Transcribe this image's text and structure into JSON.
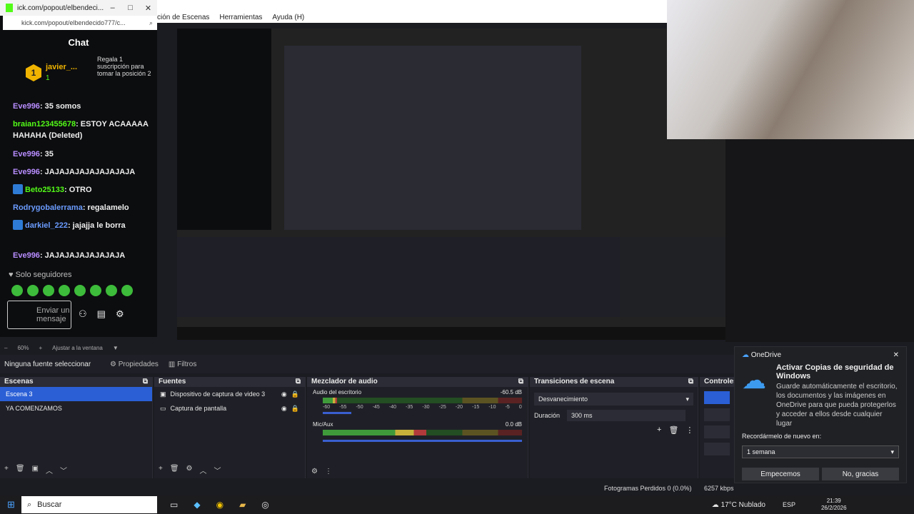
{
  "chat": {
    "window_url": "ick.com/popout/elbendeci...",
    "address": "kick.com/popout/elbendecido777/c...",
    "title": "Chat",
    "sub_badge_count": "1",
    "sub_user": "javier_...",
    "sub_user_count": "1",
    "sub_prompt": "Regala 1 suscripción para tomar la posición 2",
    "messages": [
      {
        "nick": "Eve996",
        "text": ": 35 somos"
      },
      {
        "nick": "braian123455678",
        "text": ": ESTOY ACAAAAA HAHAHA (Deleted)"
      },
      {
        "nick": "Eve996",
        "text": ": 35"
      },
      {
        "nick": "Eve996",
        "text": ": JAJAJAJAJAJAJAJAJA"
      },
      {
        "nick": "Beto25133",
        "text": ": OTRO"
      },
      {
        "nick": "Rodrygobalerrama",
        "text": ": regalamelo"
      },
      {
        "nick": "darkiel_222",
        "text": ": jajajja le borra"
      },
      {
        "nick": "Eve996",
        "text": ": JAJAJAJAJAJAJAJA"
      }
    ],
    "followers_only": "Solo seguidores",
    "send_placeholder": "Enviar un mensaje"
  },
  "obs": {
    "menu": [
      "ción de Escenas",
      "Herramientas",
      "Ayuda (H)"
    ],
    "zoom": "60%",
    "fit_label": "Ajustar a la ventana",
    "no_source": "Ninguna fuente seleccionar",
    "properties": "Propiedades",
    "filters": "Filtros",
    "scenes_title": "Escenas",
    "scenes": [
      "Escena 3",
      "YA COMENZAMOS"
    ],
    "sources_title": "Fuentes",
    "sources": [
      "Dispositivo de captura de video 3",
      "Captura de pantalla"
    ],
    "mixer_title": "Mezclador de audio",
    "mixer": [
      {
        "name": "Audio del escritorio",
        "db": "-60.5 dB",
        "level": 0.07
      },
      {
        "name": "Mic/Aux",
        "db": "0.0 dB",
        "level": 0.52
      }
    ],
    "mixer_scale": [
      "-60",
      "-55",
      "-50",
      "-45",
      "-40",
      "-35",
      "-30",
      "-25",
      "-20",
      "-15",
      "-10",
      "-5",
      "0"
    ],
    "transitions_title": "Transiciones de escena",
    "transition": "Desvanecimiento",
    "duration_label": "Duración",
    "duration_value": "300 ms",
    "controls_title": "Controles",
    "dropped_frames": "Fotogramas Perdidos 0 (0.0%)",
    "bitrate": "6257 kbps"
  },
  "onedrive": {
    "app": "OneDrive",
    "heading": "Activar Copias de seguridad de Windows",
    "body": "Guarde automáticamente el escritorio, los documentos y las imágenes en OneDrive para que pueda protegerlos y acceder a ellos desde cualquier lugar",
    "remind_label": "Recordármelo de nuevo en:",
    "remind_value": "1 semana",
    "primary": "Empecemos",
    "secondary": "No, gracias"
  },
  "taskbar": {
    "search": "Buscar",
    "weather": "17°C Nublado",
    "lang": "ESP",
    "time": "21:39",
    "date": "26/2/2026"
  }
}
